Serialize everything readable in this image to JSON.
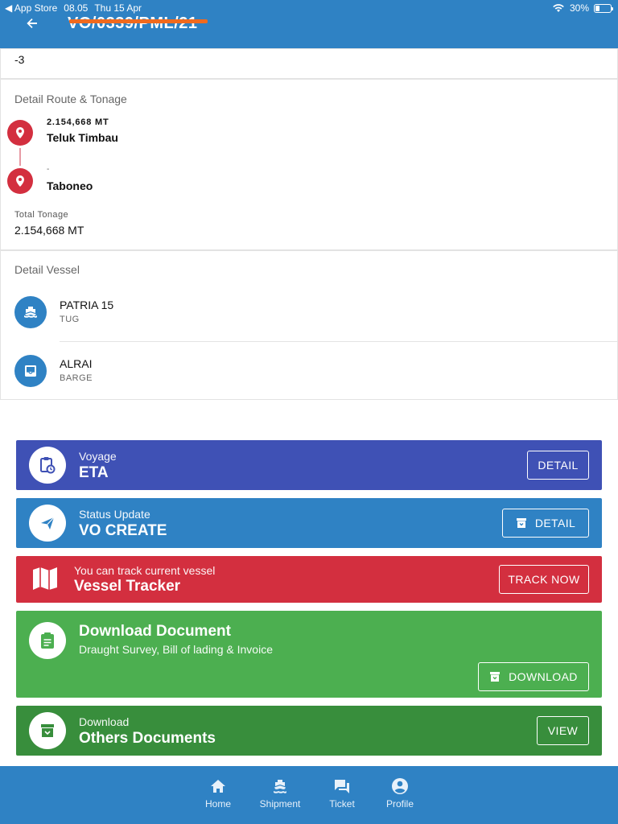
{
  "status_bar": {
    "app_store": "◀ App Store",
    "time": "08.05",
    "date": "Thu 15 Apr",
    "battery": "30%",
    "battery_level": 0.3
  },
  "header": {
    "title": "VO/0339/PML/21"
  },
  "top_value": "-3",
  "route": {
    "section_label": "Detail Route & Tonage",
    "origin": {
      "tonnage": "2.154,668 MT",
      "name": "Teluk Timbau"
    },
    "destination": {
      "tonnage": "-",
      "name": "Taboneo"
    },
    "total_label": "Total Tonage",
    "total_value": "2.154,668 MT"
  },
  "vessel": {
    "section_label": "Detail Vessel",
    "items": [
      {
        "name": "PATRIA 15",
        "type": "TUG",
        "icon": "ship-icon"
      },
      {
        "name": "ALRAI",
        "type": "BARGE",
        "icon": "inbox-icon"
      }
    ]
  },
  "actions": {
    "voyage": {
      "small": "Voyage",
      "big": "ETA",
      "button": "DETAIL",
      "color": "#3f51b5"
    },
    "status": {
      "small": "Status Update",
      "big": "VO CREATE",
      "button": "DETAIL",
      "color": "#2f82c4"
    },
    "tracker": {
      "small": "You can track current vessel",
      "big": "Vessel Tracker",
      "button": "TRACK NOW",
      "color": "#d32f3f"
    },
    "download": {
      "big": "Download Document",
      "small": "Draught Survey, Bill of lading & Invoice",
      "button": "DOWNLOAD",
      "color": "#4caf50"
    },
    "others": {
      "small": "Download",
      "big": "Others Documents",
      "button": "VIEW",
      "color": "#388e3c"
    }
  },
  "nav": [
    {
      "label": "Home",
      "icon": "home-icon"
    },
    {
      "label": "Shipment",
      "icon": "ship-icon"
    },
    {
      "label": "Ticket",
      "icon": "chat-icon"
    },
    {
      "label": "Profile",
      "icon": "account-icon"
    }
  ],
  "colors": {
    "primary": "#2f82c4",
    "pin_red": "#d32f3f",
    "accent_orange": "#f06a1e"
  }
}
